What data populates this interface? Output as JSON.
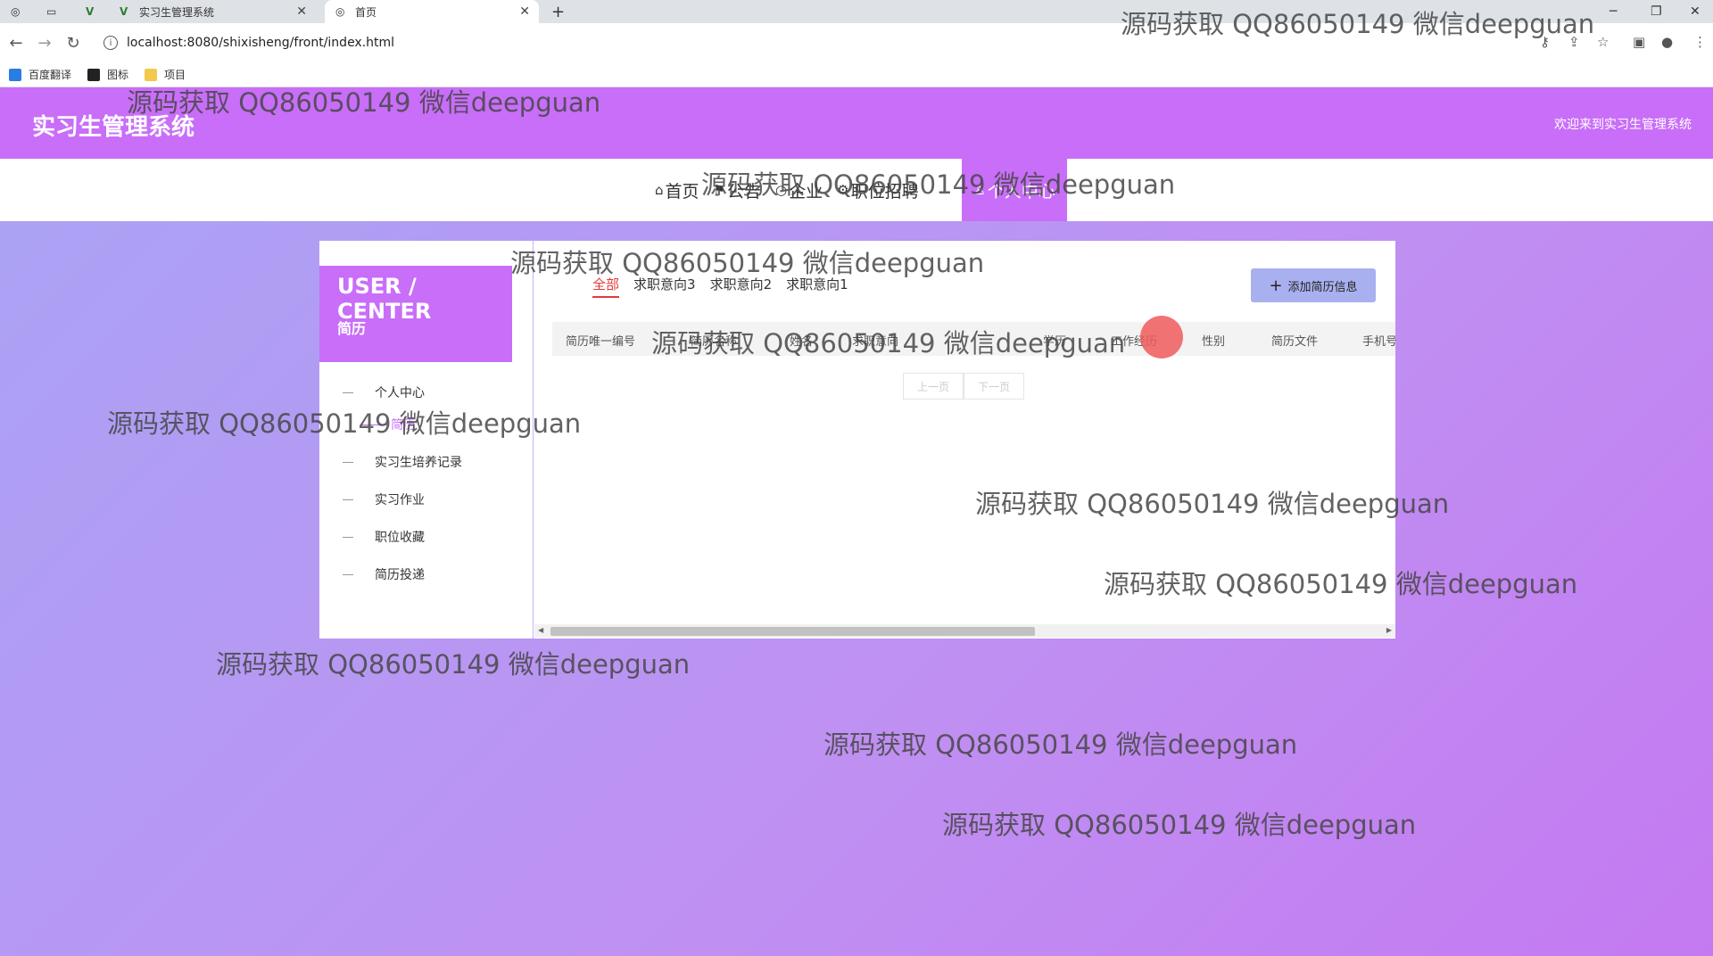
{
  "browser": {
    "tabs": [
      {
        "title": "实习生管理系统"
      },
      {
        "title": "首页"
      }
    ],
    "url": "localhost:8080/shixisheng/front/index.html",
    "bookmarks": [
      "百度翻译",
      "图标",
      "项目"
    ]
  },
  "header": {
    "title": "实习生管理系统",
    "welcome": "欢迎来到实习生管理系统"
  },
  "nav": {
    "items": [
      "首页",
      "公告",
      "企业",
      "职位招聘"
    ],
    "active": "个人中心"
  },
  "sidebar": {
    "heading": "USER / CENTER",
    "subheading": "简历",
    "items": [
      "个人中心",
      "简历",
      "实习生培养记录",
      "实习作业",
      "职位收藏",
      "简历投递"
    ]
  },
  "content": {
    "tabs": [
      "全部",
      "求职意向3",
      "求职意向2",
      "求职意向1"
    ],
    "add_button": "添加简历信息",
    "columns": [
      "简历唯一编号",
      "简历名称",
      "姓名",
      "求职意向",
      "学历",
      "工作经历",
      "性别",
      "简历文件",
      "手机号"
    ],
    "pager": {
      "prev": "上一页",
      "next": "下一页"
    }
  },
  "watermark": "源码获取 QQ86050149 微信deepguan",
  "colors": {
    "accent": "#c86ef8",
    "active_tab": "#e4393c"
  }
}
